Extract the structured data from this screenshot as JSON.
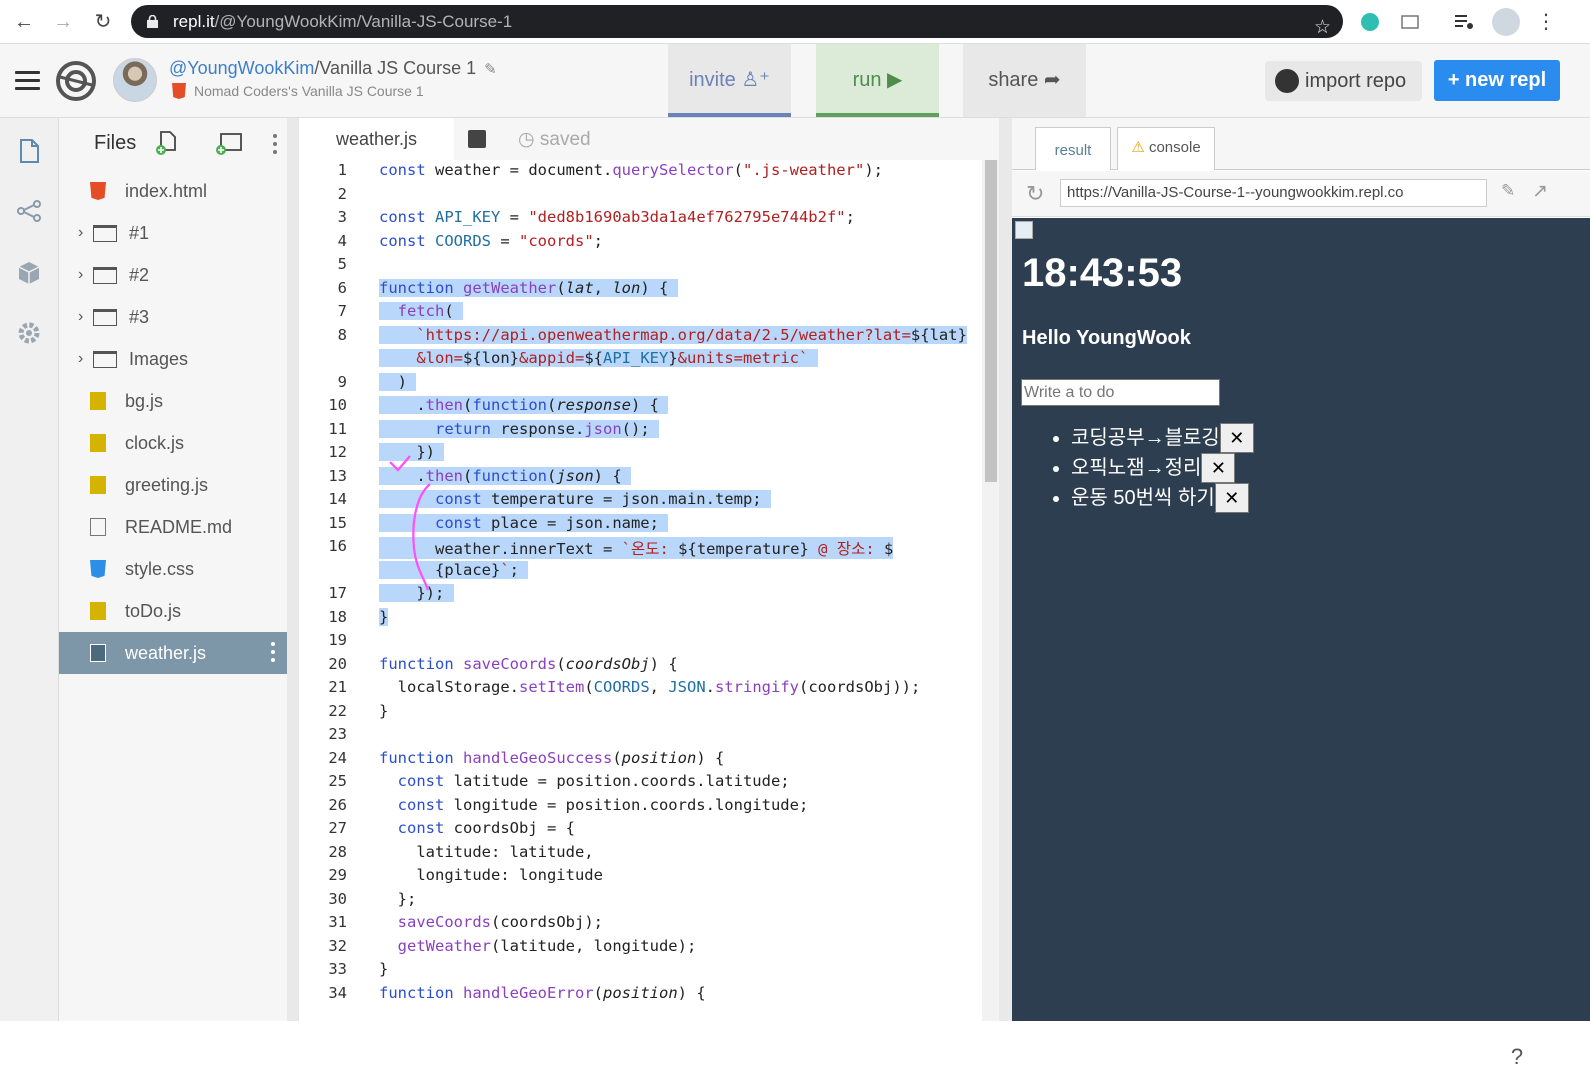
{
  "browser": {
    "url_host": "repl.it",
    "url_path": "/@YoungWookKim/Vanilla-JS-Course-1"
  },
  "header": {
    "username": "@YoungWookKim",
    "separator": "/",
    "repl_name": "Vanilla JS Course 1",
    "subtitle": "Nomad Coders's Vanilla JS Course 1",
    "invite_label": "invite",
    "run_label": "run",
    "share_label": "share",
    "import_label": "import repo",
    "new_label": "+ new repl"
  },
  "files": {
    "title": "Files",
    "items": [
      {
        "name": "index.html",
        "type": "html"
      },
      {
        "name": "#1",
        "type": "folder"
      },
      {
        "name": "#2",
        "type": "folder"
      },
      {
        "name": "#3",
        "type": "folder"
      },
      {
        "name": "Images",
        "type": "folder"
      },
      {
        "name": "bg.js",
        "type": "js"
      },
      {
        "name": "clock.js",
        "type": "js"
      },
      {
        "name": "greeting.js",
        "type": "js"
      },
      {
        "name": "README.md",
        "type": "md"
      },
      {
        "name": "style.css",
        "type": "css"
      },
      {
        "name": "toDo.js",
        "type": "js"
      },
      {
        "name": "weather.js",
        "type": "js",
        "active": true
      }
    ]
  },
  "editor": {
    "tab_name": "weather.js",
    "status": "saved",
    "line_numbers": [
      "1",
      "2",
      "3",
      "4",
      "5",
      "6",
      "7",
      "8",
      "",
      "9",
      "10",
      "11",
      "12",
      "13",
      "14",
      "15",
      "16",
      "",
      "17",
      "18",
      "19",
      "20",
      "21",
      "22",
      "23",
      "24",
      "25",
      "26",
      "27",
      "28",
      "29",
      "30",
      "31",
      "32",
      "33",
      "34"
    ]
  },
  "preview": {
    "tab_result": "result",
    "tab_console": "console",
    "url": "https://Vanilla-JS-Course-1--youngwookkim.repl.co",
    "clock": "18:43:53",
    "greeting": "Hello YoungWook",
    "todo_placeholder": "Write a to do",
    "todos": [
      "코딩공부→블로깅",
      "오픽노잼→정리",
      "운동 50번씩 하기"
    ],
    "delete_glyph": "✕",
    "help": "?"
  },
  "colors": {
    "accent_blue": "#2b8cf0",
    "run_green": "#5fa05b",
    "invite_blue": "#6b82b6",
    "preview_bg": "#2d3e50",
    "selection": "#b9d7fb"
  }
}
